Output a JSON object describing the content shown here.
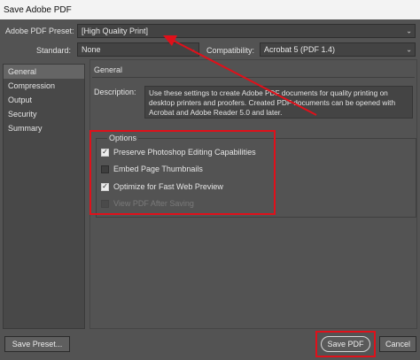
{
  "window": {
    "title": "Save Adobe PDF"
  },
  "preset": {
    "label": "Adobe PDF Preset:",
    "value": "[High Quality Print]"
  },
  "standard": {
    "label": "Standard:",
    "value": "None"
  },
  "compatibility": {
    "label": "Compatibility:",
    "value": "Acrobat 5 (PDF 1.4)"
  },
  "sidebar": {
    "items": [
      {
        "label": "General",
        "selected": true
      },
      {
        "label": "Compression",
        "selected": false
      },
      {
        "label": "Output",
        "selected": false
      },
      {
        "label": "Security",
        "selected": false
      },
      {
        "label": "Summary",
        "selected": false
      }
    ]
  },
  "panel": {
    "heading": "General",
    "description_label": "Description:",
    "description_text": "Use these settings to create Adobe PDF documents for quality printing on desktop printers and proofers.  Created PDF documents can be opened with Acrobat and Adobe Reader 5.0 and later."
  },
  "options": {
    "legend": "Options",
    "items": [
      {
        "label": "Preserve Photoshop Editing Capabilities",
        "checked": true,
        "disabled": false
      },
      {
        "label": "Embed Page Thumbnails",
        "checked": false,
        "disabled": false
      },
      {
        "label": "Optimize for Fast Web Preview",
        "checked": true,
        "disabled": false
      },
      {
        "label": "View PDF After Saving",
        "checked": false,
        "disabled": true
      }
    ]
  },
  "buttons": {
    "save_preset": "Save Preset...",
    "save_pdf": "Save PDF",
    "cancel": "Cancel"
  },
  "colors": {
    "background": "#535353",
    "annotation_red": "#e0101a"
  }
}
